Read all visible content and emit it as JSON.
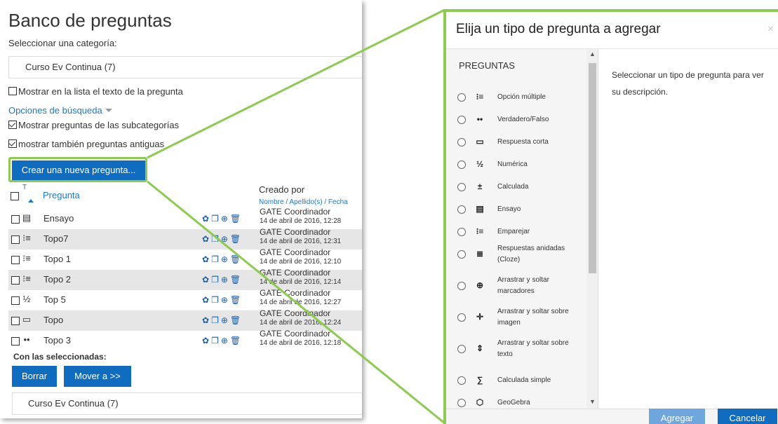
{
  "bank": {
    "title": "Banco de preguntas",
    "category_label": "Seleccionar una categoría:",
    "category_value": "Curso Ev Continua (7)",
    "show_text_label": "Mostrar en la lista el texto de la pregunta",
    "search_options": "Opciones de búsqueda",
    "show_subcats_label": "Mostrar preguntas de las subcategorías",
    "show_old_label": "mostrar también preguntas antiguas",
    "create_button": "Crear una nueva pregunta...",
    "header_sort_mark": "T",
    "header_question": "Pregunta",
    "header_created_by": "Creado por",
    "header_sort_links": "Nombre / Apellido(s) / Fecha",
    "questions": [
      {
        "icon": "essay-icon",
        "name": "Ensayo",
        "creator": "GATE Coordinador",
        "date": "14 de abril de 2016, 12:28"
      },
      {
        "icon": "matching-icon",
        "name": "Topo7",
        "creator": "GATE Coordinador",
        "date": "14 de abril de 2016, 12:31"
      },
      {
        "icon": "multichoice-icon",
        "name": "Topo 1",
        "creator": "GATE Coordinador",
        "date": "14 de abril de 2016, 12:10"
      },
      {
        "icon": "multichoice-icon",
        "name": "Topo 2",
        "creator": "GATE Coordinador",
        "date": "14 de abril de 2016, 12:14"
      },
      {
        "icon": "numerical-icon",
        "name": "Top 5",
        "creator": "GATE Coordinador",
        "date": "14 de abril de 2016, 12:27"
      },
      {
        "icon": "shortanswer-icon",
        "name": "Topo",
        "creator": "GATE Coordinador",
        "date": "14 de abril de 2016, 12:24"
      },
      {
        "icon": "truefalse-icon",
        "name": "Topo 3",
        "creator": "GATE Coordinador",
        "date": "14 de abril de 2016, 12:18"
      }
    ],
    "with_selected": "Con las seleccionadas:",
    "delete_button": "Borrar",
    "move_button": "Mover a >>",
    "bottom_category": "Curso Ev Continua (7)"
  },
  "dialog": {
    "title": "Elija un tipo de pregunta a agregar",
    "close": "×",
    "list_header": "PREGUNTAS",
    "description": "Seleccionar un tipo de pregunta para ver su descripción.",
    "types": [
      {
        "icon": "multichoice-icon",
        "label": "Opción múltiple"
      },
      {
        "icon": "truefalse-icon",
        "label": "Verdadero/Falso"
      },
      {
        "icon": "shortanswer-icon",
        "label": "Respuesta corta"
      },
      {
        "icon": "numerical-icon",
        "label": "Numérica"
      },
      {
        "icon": "calculated-icon",
        "label": "Calculada"
      },
      {
        "icon": "essay-icon",
        "label": "Ensayo"
      },
      {
        "icon": "matching-icon",
        "label": "Emparejar"
      },
      {
        "icon": "cloze-icon",
        "label": "Respuestas anidadas (Cloze)"
      },
      {
        "icon": "ddmarker-icon",
        "label": "Arrastrar y soltar marcadores"
      },
      {
        "icon": "ddimage-icon",
        "label": "Arrastrar y soltar sobre imagen"
      },
      {
        "icon": "ddtext-icon",
        "label": "Arrastrar y soltar sobre texto"
      },
      {
        "icon": "calculatedsimple-icon",
        "label": "Calculada simple"
      },
      {
        "icon": "geogebra-icon",
        "label": "GeoGebra"
      }
    ],
    "add_button": "Agregar",
    "cancel_button": "Cancelar"
  },
  "colors": {
    "accent": "#0f6cbf",
    "highlight": "#8ccb4f",
    "link": "#1b78c9"
  }
}
